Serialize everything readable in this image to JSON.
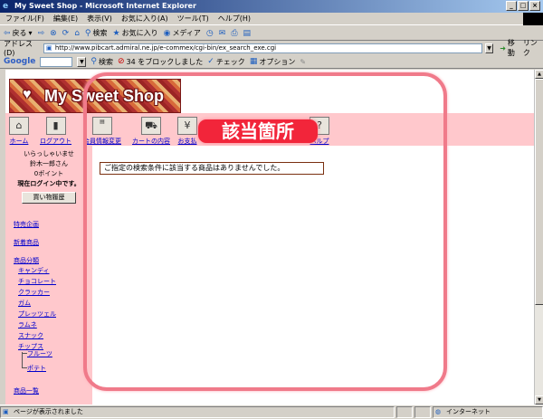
{
  "window": {
    "title": "My Sweet Shop - Microsoft Internet Explorer",
    "buttons": [
      "_",
      "□",
      "×"
    ]
  },
  "menu": [
    "ファイル(F)",
    "編集(E)",
    "表示(V)",
    "お気に入り(A)",
    "ツール(T)",
    "ヘルプ(H)"
  ],
  "toolbar": {
    "back": "戻る",
    "search": "検索",
    "favorites": "お気に入り",
    "media": "メディア"
  },
  "address": {
    "label": "アドレス(D)",
    "url": "http://www.pibcart.admiral.ne.jp/e-commex/cgi-bin/ex_search_exe.cgi",
    "go_label": "移動",
    "links_label": "リンク"
  },
  "google": {
    "logo": "Google",
    "search_label": "検索",
    "blocked": "34 をブロックしました",
    "check": "チェック",
    "options": "オプション"
  },
  "shop": {
    "logo_text": "My Sweet Shop"
  },
  "nav": [
    {
      "label": "ホーム",
      "icon": "house-icon"
    },
    {
      "label": "ログアウト",
      "icon": "door-icon"
    },
    {
      "label": "会員情報変更",
      "icon": "card-icon"
    },
    {
      "label": "カートの内容",
      "icon": "cart-icon"
    },
    {
      "label": "お支払",
      "icon": "yen-icon"
    },
    {
      "label": "ヘルプ",
      "icon": "help-icon"
    }
  ],
  "sidebar": {
    "greeting": "いらっしゃいませ",
    "user": "鈴木一郎さん",
    "points": "0ポイント",
    "login_status": "現在ログイン中です。",
    "history_button": "買い物履歴",
    "links": {
      "special": "特売企画",
      "new": "新着商品",
      "category": "商品分類",
      "all": "商品一覧"
    },
    "categories": [
      "キャンディ",
      "チョコレート",
      "クラッカー",
      "ガム",
      "プレッツェル",
      "ラムネ",
      "スナック",
      "チップス"
    ],
    "subcategories": [
      "フルーツ",
      "ポテト"
    ]
  },
  "main": {
    "message": "ご指定の検索条件に該当する商品はありませんでした。"
  },
  "annotation": {
    "callout": "該当箇所"
  },
  "status": {
    "text": "ページが表示されました",
    "zone": "インターネット"
  }
}
